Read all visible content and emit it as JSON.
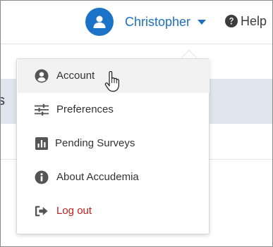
{
  "header": {
    "user_name": "Christopher",
    "help_label": "Help"
  },
  "background": {
    "band_fragment": "s"
  },
  "menu": {
    "items": [
      {
        "label": "Account",
        "icon": "account-circle-icon",
        "active": true
      },
      {
        "label": "Preferences",
        "icon": "sliders-icon",
        "active": false
      },
      {
        "label": "Pending Surveys",
        "icon": "bar-chart-icon",
        "active": false
      },
      {
        "label": "About Accudemia",
        "icon": "info-icon",
        "active": false
      },
      {
        "label": "Log out",
        "icon": "logout-icon",
        "active": false
      }
    ]
  },
  "colors": {
    "brand": "#1a73c7",
    "link": "#1d6fbf",
    "danger": "#c0201c"
  }
}
